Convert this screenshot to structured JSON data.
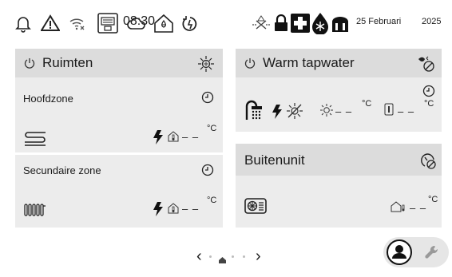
{
  "status": {
    "time": "08:30",
    "date": "25 Februari",
    "year": "2025",
    "icons": [
      "bell-icon",
      "warning-icon",
      "wifi-off-icon",
      "network-card-icon",
      "cloud-icon",
      "house-water-icon",
      "timer-icon",
      "valve-warning-icon",
      "lock-icon",
      "first-aid-icon",
      "defrost-icon",
      "reservoir-icon"
    ]
  },
  "ruimten": {
    "title": "Ruimten",
    "zone1": {
      "name": "Hoofdzone",
      "temp": "– –",
      "unit": "°C"
    },
    "zone2": {
      "name": "Secundaire zone",
      "temp": "– –",
      "unit": "°C"
    }
  },
  "tapwater": {
    "title": "Warm tapwater",
    "temp1": "– –",
    "unit1": "°C",
    "temp2": "– –",
    "unit2": "°C"
  },
  "buitenunit": {
    "title": "Buitenunit",
    "temp": "– –",
    "unit": "°C"
  },
  "pager": {
    "prev": "‹",
    "next": "›",
    "pages": 4,
    "current": 2
  },
  "colors": {
    "card_bg": "#ececec",
    "card_header": "#dcdcdc",
    "text": "#1a1a1a"
  }
}
